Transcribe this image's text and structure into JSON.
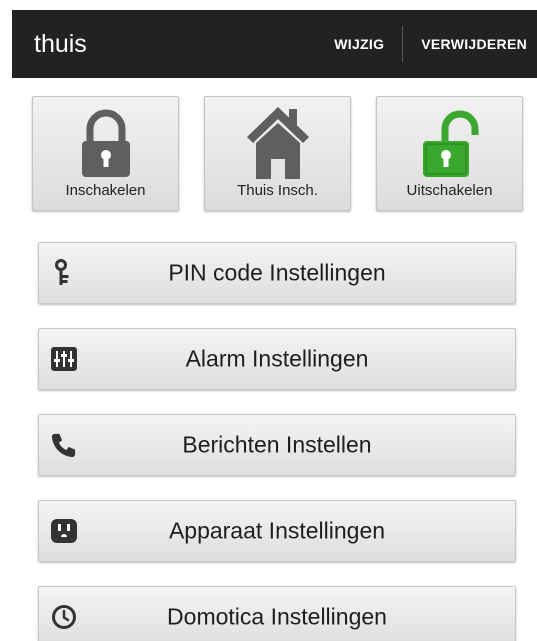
{
  "app_bar": {
    "title": "thuis",
    "edit_label": "WIJZIG",
    "delete_label": "VERWIJDEREN"
  },
  "modes": [
    {
      "label": "Inschakelen",
      "icon": "locked-padlock-icon"
    },
    {
      "label": "Thuis Insch.",
      "icon": "house-icon"
    },
    {
      "label": "Uitschakelen",
      "icon": "unlocked-padlock-icon"
    }
  ],
  "menu": [
    {
      "label": "PIN code Instellingen",
      "icon": "key-icon"
    },
    {
      "label": "Alarm Instellingen",
      "icon": "sliders-icon"
    },
    {
      "label": "Berichten Instellen",
      "icon": "phone-icon"
    },
    {
      "label": "Apparaat Instellingen",
      "icon": "power-outlet-icon"
    },
    {
      "label": "Domotica Instellingen",
      "icon": "clock-icon"
    }
  ],
  "colors": {
    "app_bar": "#222222",
    "icon_gray": "#5f5f5f",
    "unlocked_green": "#3aa82e"
  }
}
